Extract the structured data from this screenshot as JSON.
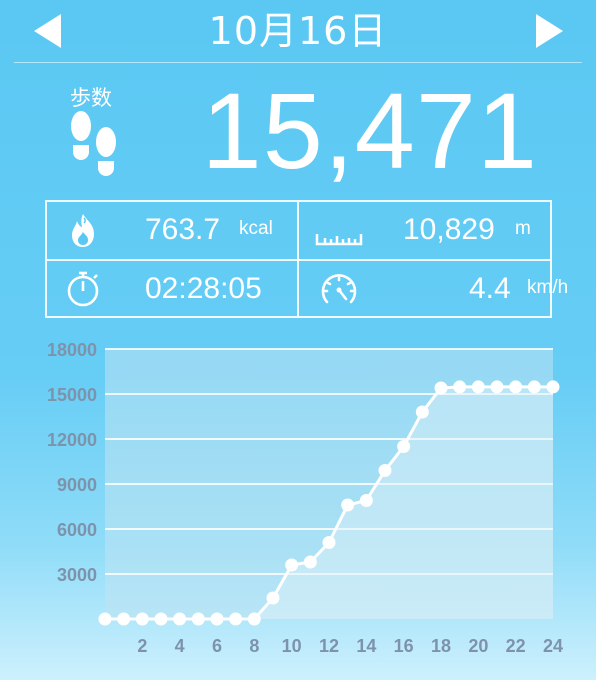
{
  "header": {
    "date": "10月16日",
    "prev_icon": "left-triangle-icon",
    "next_icon": "right-triangle-icon"
  },
  "steps": {
    "label": "歩数",
    "icon": "footprints-icon",
    "value": "15,471"
  },
  "stats": {
    "calories": {
      "icon": "flame-icon",
      "value": "763.7",
      "unit": "kcal"
    },
    "distance": {
      "icon": "ruler-icon",
      "value": "10,829",
      "unit": "m"
    },
    "time": {
      "icon": "stopwatch-icon",
      "value": "02:28:05",
      "unit": ""
    },
    "speed": {
      "icon": "speedometer-icon",
      "value": "4.4",
      "unit": "km/h"
    }
  },
  "colors": {
    "background": "#5ac8f3",
    "plot_fill": "#bfe4f2",
    "tick_label": "#7d93ab",
    "line": "#ffffff"
  },
  "chart_data": {
    "type": "line",
    "title": "",
    "xlabel": "",
    "ylabel": "",
    "x": [
      0,
      1,
      2,
      3,
      4,
      5,
      6,
      7,
      8,
      9,
      10,
      11,
      12,
      13,
      14,
      15,
      16,
      17,
      18,
      19,
      20,
      21,
      22,
      23,
      24
    ],
    "x_tick_labels": [
      "2",
      "4",
      "6",
      "8",
      "10",
      "12",
      "14",
      "16",
      "18",
      "20",
      "22",
      "24"
    ],
    "y_tick_labels": [
      "3000",
      "6000",
      "9000",
      "12000",
      "15000",
      "18000"
    ],
    "series": [
      {
        "values": [
          0,
          0,
          0,
          0,
          0,
          0,
          0,
          0,
          0,
          1400,
          3600,
          3800,
          5100,
          7600,
          7900,
          9900,
          11500,
          13800,
          15400,
          15471,
          15471,
          15471,
          15471,
          15471,
          15471
        ]
      }
    ],
    "xlim": [
      0,
      24
    ],
    "ylim": [
      0,
      18000
    ],
    "grid": true
  }
}
